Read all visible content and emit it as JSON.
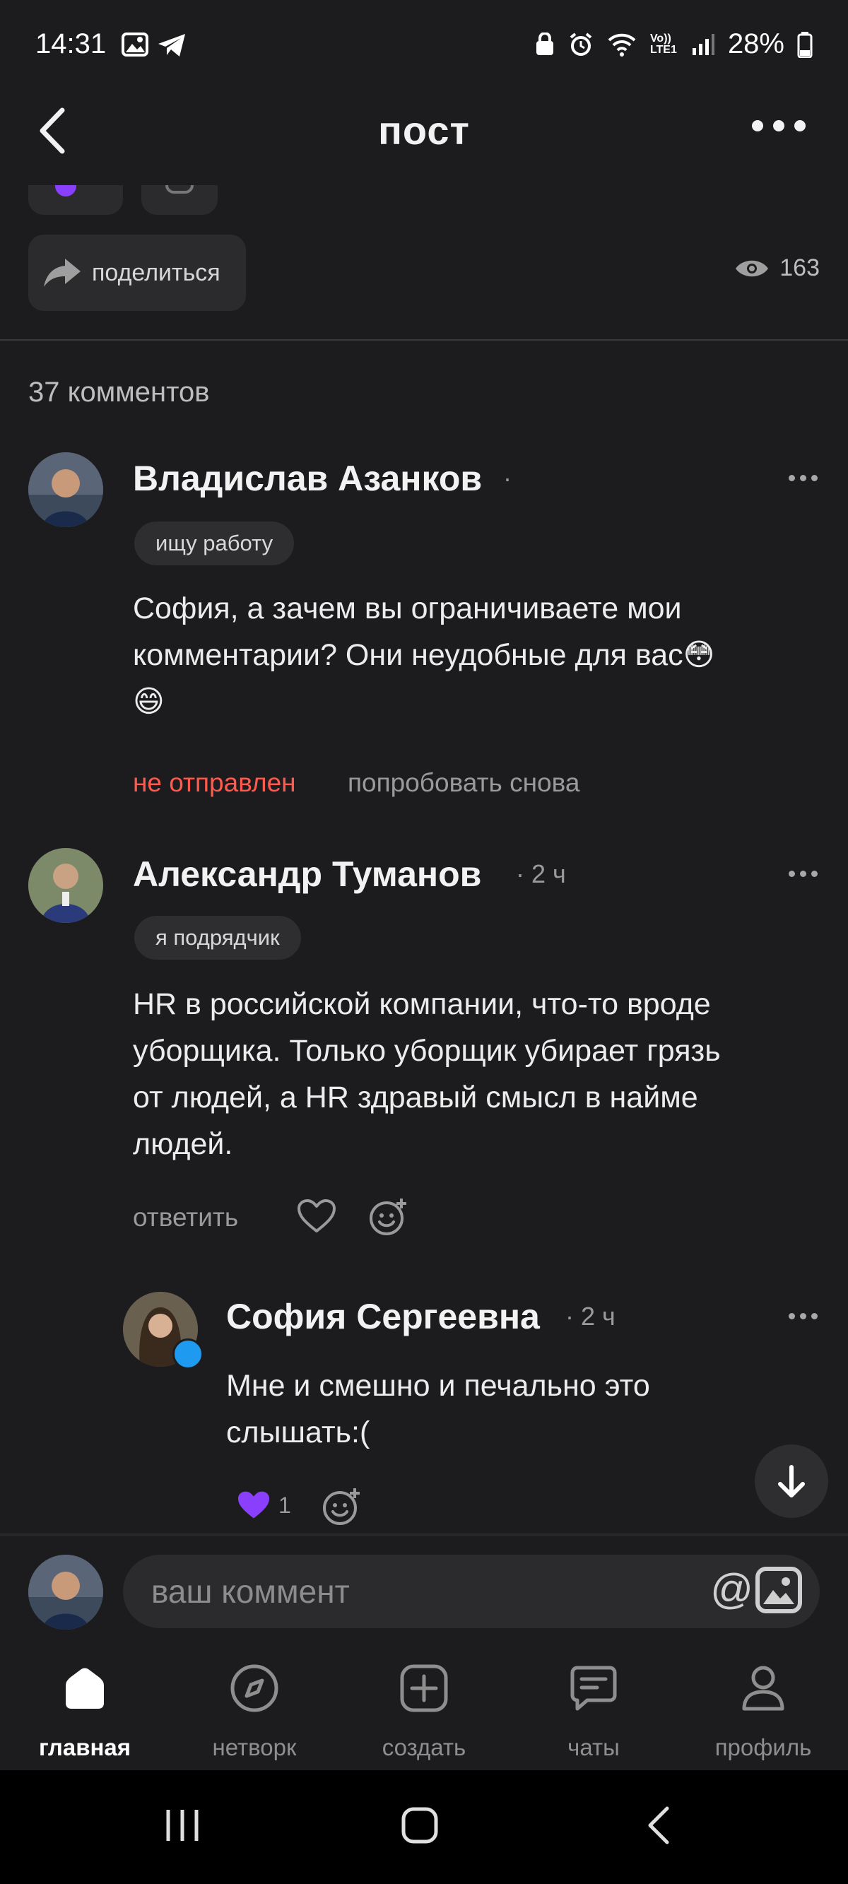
{
  "status_bar": {
    "time": "14:31",
    "network": "Vo)) LTE1",
    "battery": "28%"
  },
  "header": {
    "title": "пост"
  },
  "post_actions": {
    "share_label": "поделиться",
    "views": "163"
  },
  "comments": {
    "count_label": "37 комментов",
    "items": [
      {
        "author": "Владислав Азанков",
        "meta": "·",
        "tag": "ищу работу",
        "text_line1": "София, а зачем вы ограничиваете мои",
        "text_line2": "комментарии? Они неудобные для вас😳",
        "text_line3": "😄",
        "status": "не отправлен",
        "retry": "попробовать снова"
      },
      {
        "author": "Александр Туманов",
        "meta": "· 2 ч",
        "tag": "я подрядчик",
        "text_line1": "HR в российской компании, что-то вроде",
        "text_line2": "уборщика. Только уборщик убирает грязь",
        "text_line3": "от людей, а HR здравый смысл в найме",
        "text_line4": "людей.",
        "reply": "ответить"
      },
      {
        "author": "София Сергеевна",
        "meta": "· 2 ч",
        "text_line1": "Мне и смешно и печально это",
        "text_line2": "слышать:(",
        "reaction_emoji": "💜",
        "reaction_count": "1"
      }
    ]
  },
  "composer": {
    "placeholder": "ваш коммент",
    "mention_symbol": "@"
  },
  "bottom_nav": [
    {
      "label": "главная",
      "icon": "home-icon",
      "active": true
    },
    {
      "label": "нетворк",
      "icon": "compass-icon"
    },
    {
      "label": "создать",
      "icon": "plus-square-icon"
    },
    {
      "label": "чаты",
      "icon": "chat-icon"
    },
    {
      "label": "профиль",
      "icon": "profile-icon"
    }
  ],
  "colors": {
    "background": "#1c1c1e",
    "error": "#ff5a4e",
    "reaction": "#8a3ffc"
  }
}
